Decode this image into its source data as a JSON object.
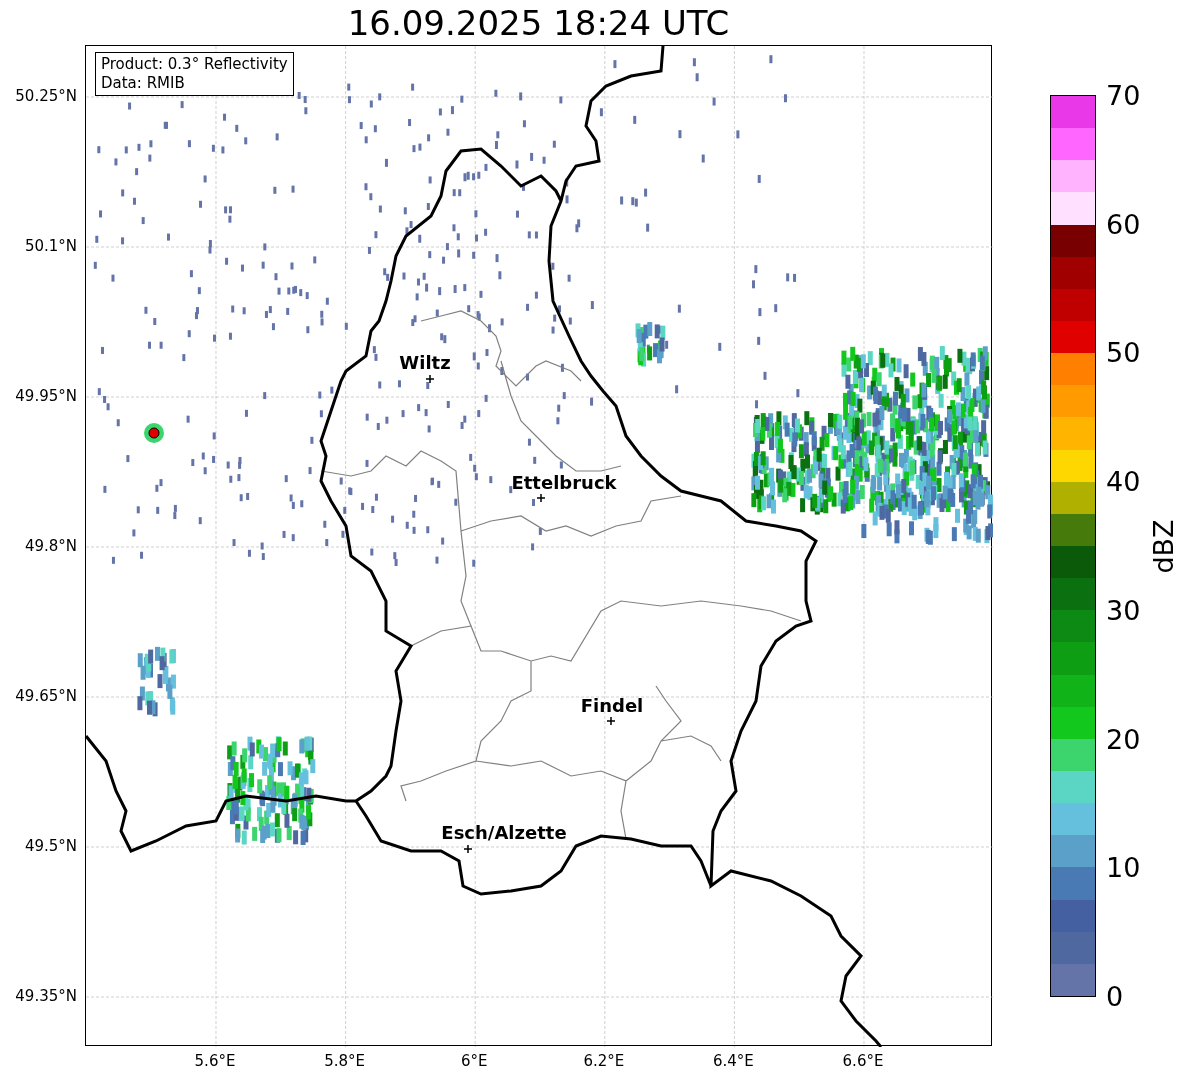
{
  "title": "16.09.2025 18:24 UTC",
  "legend": {
    "lines": [
      "Product: 0.3° Reflectivity",
      "Data: RMIB"
    ]
  },
  "map": {
    "y_ticks": [
      "50.25°N",
      "50.1°N",
      "49.95°N",
      "49.8°N",
      "49.65°N",
      "49.5°N",
      "49.35°N"
    ],
    "x_ticks": [
      "5.6°E",
      "5.8°E",
      "6°E",
      "6.2°E",
      "6.4°E",
      "6.6°E"
    ],
    "cities": [
      {
        "name": "Wiltz"
      },
      {
        "name": "Ettelbruck"
      },
      {
        "name": "Findel"
      },
      {
        "name": "Esch/Alzette"
      }
    ]
  },
  "colorbar": {
    "label": "dBZ",
    "ticks": [
      "70",
      "60",
      "50",
      "40",
      "30",
      "20",
      "10",
      "0"
    ],
    "bands": [
      {
        "color": "#e838e8"
      },
      {
        "color": "#ff66ff"
      },
      {
        "color": "#ffb3ff"
      },
      {
        "color": "#ffe0ff"
      },
      {
        "color": "#780000"
      },
      {
        "color": "#a00000"
      },
      {
        "color": "#c00000"
      },
      {
        "color": "#e00000"
      },
      {
        "color": "#ff7f00"
      },
      {
        "color": "#ff9a00"
      },
      {
        "color": "#ffb400"
      },
      {
        "color": "#ffd700"
      },
      {
        "color": "#b0b000"
      },
      {
        "color": "#467a0a"
      },
      {
        "color": "#0a5a0a"
      },
      {
        "color": "#0a7010"
      },
      {
        "color": "#0c8a14"
      },
      {
        "color": "#0e9e14"
      },
      {
        "color": "#10b418"
      },
      {
        "color": "#12c81c"
      },
      {
        "color": "#3cd46c"
      },
      {
        "color": "#5cd6c4"
      },
      {
        "color": "#64c0dc"
      },
      {
        "color": "#5aa0c8"
      },
      {
        "color": "#4a7ab4"
      },
      {
        "color": "#4460a0"
      },
      {
        "color": "#5068a0"
      },
      {
        "color": "#6474a8"
      }
    ]
  }
}
